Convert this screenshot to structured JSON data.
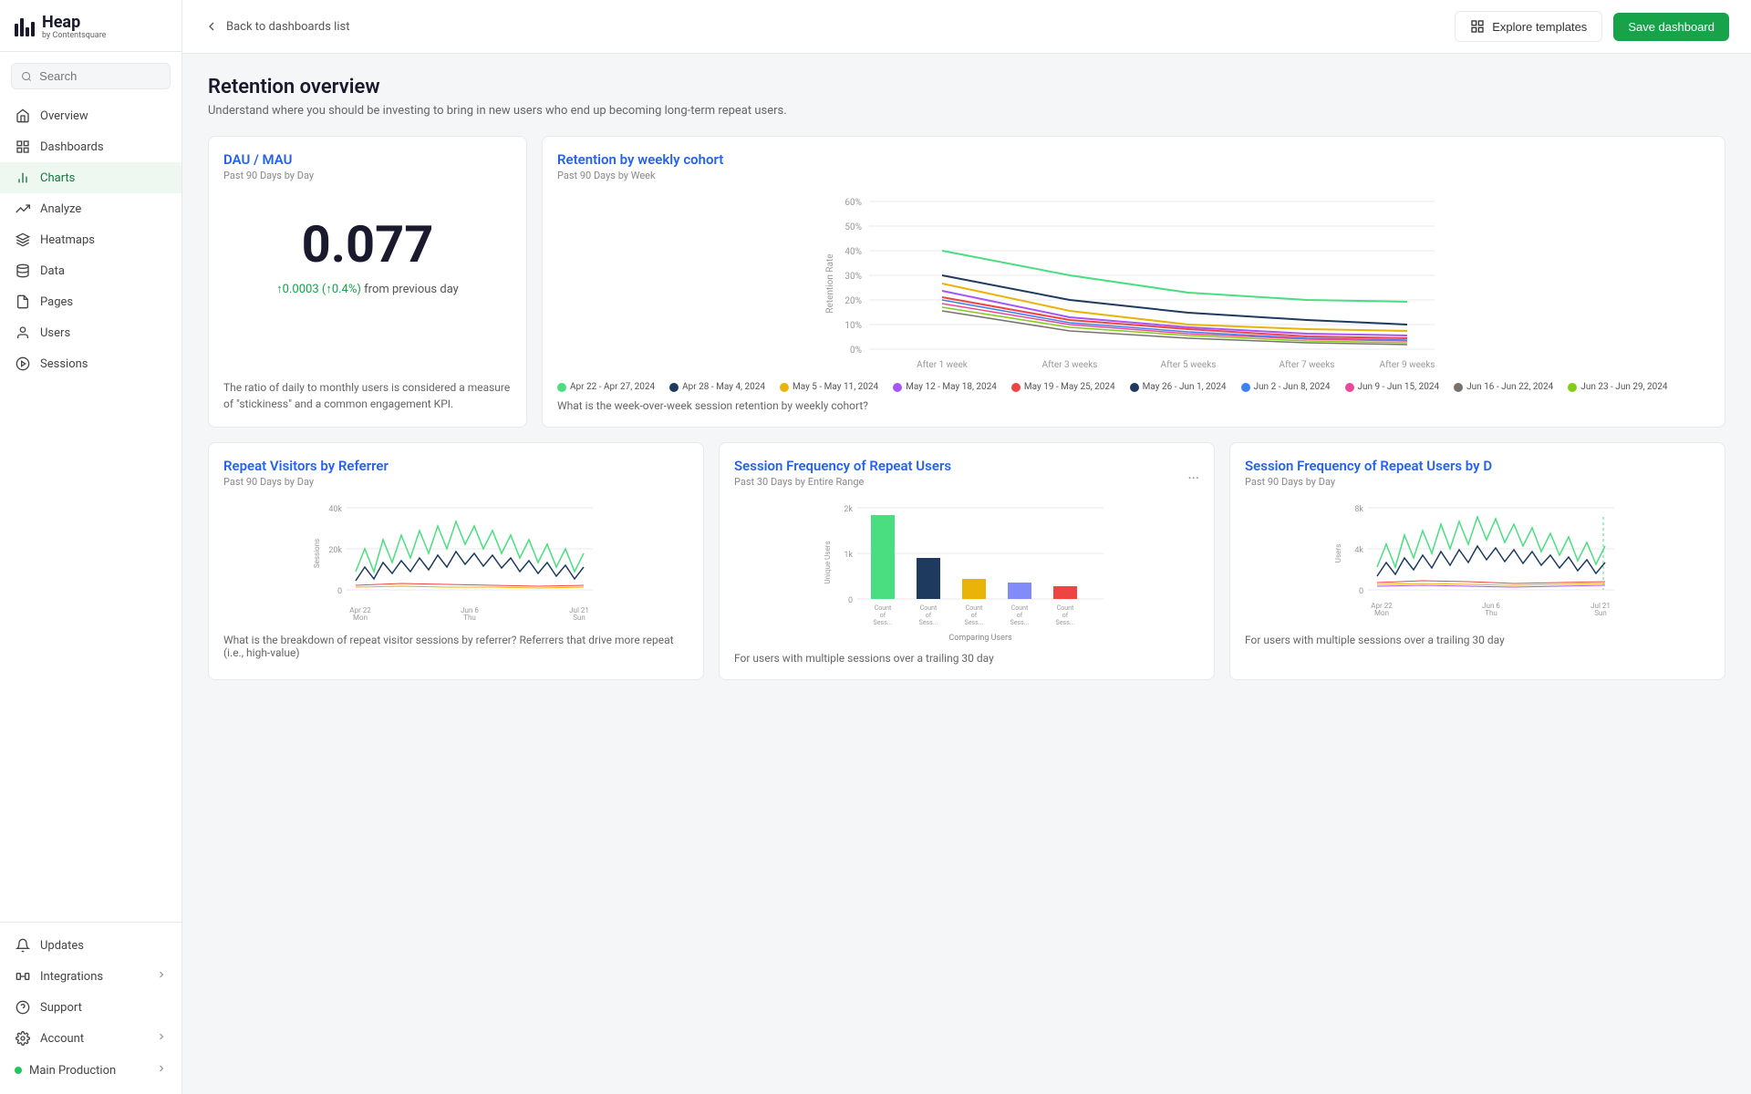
{
  "logo": {
    "main": "Heap",
    "sub": "by Contentsquare"
  },
  "sidebar": {
    "search_placeholder": "Search",
    "nav_items": [
      {
        "id": "overview",
        "label": "Overview",
        "icon": "home"
      },
      {
        "id": "dashboards",
        "label": "Dashboards",
        "icon": "grid"
      },
      {
        "id": "charts",
        "label": "Charts",
        "icon": "bar-chart"
      },
      {
        "id": "analyze",
        "label": "Analyze",
        "icon": "trending-up"
      },
      {
        "id": "heatmaps",
        "label": "Heatmaps",
        "icon": "layers"
      },
      {
        "id": "data",
        "label": "Data",
        "icon": "database"
      },
      {
        "id": "pages",
        "label": "Pages",
        "icon": "file"
      },
      {
        "id": "users",
        "label": "Users",
        "icon": "user"
      },
      {
        "id": "sessions",
        "label": "Sessions",
        "icon": "play-circle"
      }
    ],
    "bottom_items": [
      {
        "id": "updates",
        "label": "Updates",
        "icon": "bell"
      },
      {
        "id": "integrations",
        "label": "Integrations",
        "icon": "layers",
        "has_chevron": true
      },
      {
        "id": "support",
        "label": "Support",
        "icon": "help-circle"
      },
      {
        "id": "account",
        "label": "Account",
        "icon": "settings",
        "has_chevron": true
      }
    ],
    "env": {
      "label": "Main Production",
      "has_chevron": true
    }
  },
  "topbar": {
    "back_label": "Back to dashboards list",
    "explore_label": "Explore templates",
    "save_label": "Save dashboard"
  },
  "page": {
    "title": "Retention overview",
    "subtitle": "Understand where you should be investing to bring in new users who end up becoming long-term repeat users."
  },
  "dau_mau": {
    "title": "DAU / MAU",
    "period": "Past 90 Days by Day",
    "value": "0.077",
    "change_value": "↑0.0003",
    "change_pct": "(↑0.4%)",
    "change_suffix": "from previous day",
    "description": "The ratio of daily to monthly users is considered a measure of \"stickiness\" and a common engagement KPI."
  },
  "retention_weekly": {
    "title": "Retention by weekly cohort",
    "period": "Past 90 Days by Week",
    "question": "What is the week-over-week session retention by weekly cohort?",
    "y_labels": [
      "60%",
      "50%",
      "40%",
      "30%",
      "20%",
      "10%",
      "0%"
    ],
    "x_labels": [
      "After 1 week",
      "After 3 weeks",
      "After 5 weeks",
      "After 7 weeks",
      "After 9 weeks"
    ],
    "legend": [
      {
        "label": "Apr 22 - Apr 27, 2024",
        "color": "#4ade80"
      },
      {
        "label": "Apr 28 - May 4, 2024",
        "color": "#1e3a5f"
      },
      {
        "label": "May 5 - May 11, 2024",
        "color": "#eab308"
      },
      {
        "label": "May 12 - May 18, 2024",
        "color": "#a855f7"
      },
      {
        "label": "May 19 - May 25, 2024",
        "color": "#ef4444"
      },
      {
        "label": "May 26 - Jun 1, 2024",
        "color": "#1e3a5f"
      },
      {
        "label": "Jun 2 - Jun 8, 2024",
        "color": "#3b82f6"
      },
      {
        "label": "Jun 9 - Jun 15, 2024",
        "color": "#ec4899"
      },
      {
        "label": "Jun 16 - Jun 22, 2024",
        "color": "#78716c"
      },
      {
        "label": "Jun 23 - Jun 29, 2024",
        "color": "#84cc16"
      }
    ]
  },
  "repeat_visitors": {
    "title": "Repeat Visitors by Referrer",
    "period": "Past 90 Days by Day",
    "question": "What is the breakdown of repeat visitor sessions by referrer? Referrers that drive more repeat (i.e., high-value)",
    "y_labels": [
      "40k",
      "20k",
      "0"
    ],
    "x_labels": [
      "Apr 22\nMon",
      "Jun 6\nThu",
      "Jul 21\nSun"
    ]
  },
  "session_freq": {
    "title": "Session Frequency of Repeat Users",
    "period": "Past 30 Days by Entire Range",
    "question": "For users with multiple sessions over a trailing 30 day",
    "y_labels": [
      "2k",
      "1k",
      "0"
    ],
    "x_labels": [
      "Count of Sess...",
      "Count of Sess...",
      "Count of Sess...",
      "Count of Sess...",
      "Count of Sess..."
    ],
    "comparing": "Comparing Users"
  },
  "session_freq_b": {
    "title": "Session Frequency of Repeat Users by D",
    "period": "Past 90 Days by Day",
    "question": "For users with multiple sessions over a trailing 30 day",
    "y_labels": [
      "8k",
      "4k",
      "0"
    ],
    "x_labels": [
      "Apr 22\nMon",
      "Jun 6\nThu",
      "Jul 21\nSun"
    ]
  }
}
